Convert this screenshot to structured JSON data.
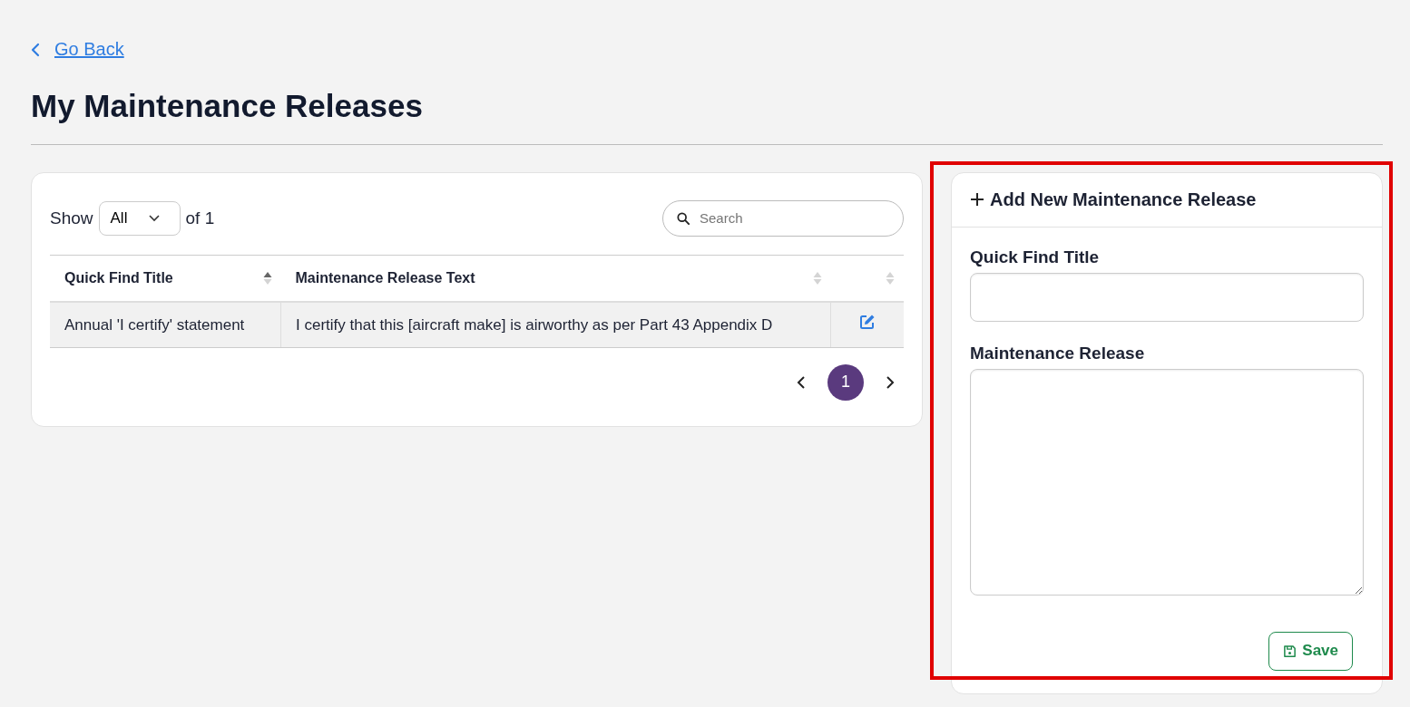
{
  "back_link": {
    "label": "Go Back"
  },
  "title": "My Maintenance Releases",
  "list": {
    "show_label": "Show",
    "page_size": "All",
    "of_label": "of 1",
    "search": {
      "placeholder": "Search"
    },
    "columns": [
      {
        "label": "Quick Find Title",
        "sorted": true
      },
      {
        "label": "Maintenance Release Text",
        "sorted": false
      },
      {
        "sorted": false
      }
    ],
    "rows": [
      {
        "title": "Annual 'I certify' statement",
        "text": "I certify that this [aircraft make] is airworthy as per Part 43 Appendix D"
      }
    ],
    "pages": [
      {
        "label": "1",
        "selected": true
      }
    ]
  },
  "form": {
    "title": "Add New Maintenance Release",
    "highlighted": true,
    "fields": [
      {
        "kind": "input",
        "label": "Quick Find Title"
      },
      {
        "kind": "textarea",
        "label": "Maintenance Release"
      }
    ],
    "save_button": "Save"
  }
}
